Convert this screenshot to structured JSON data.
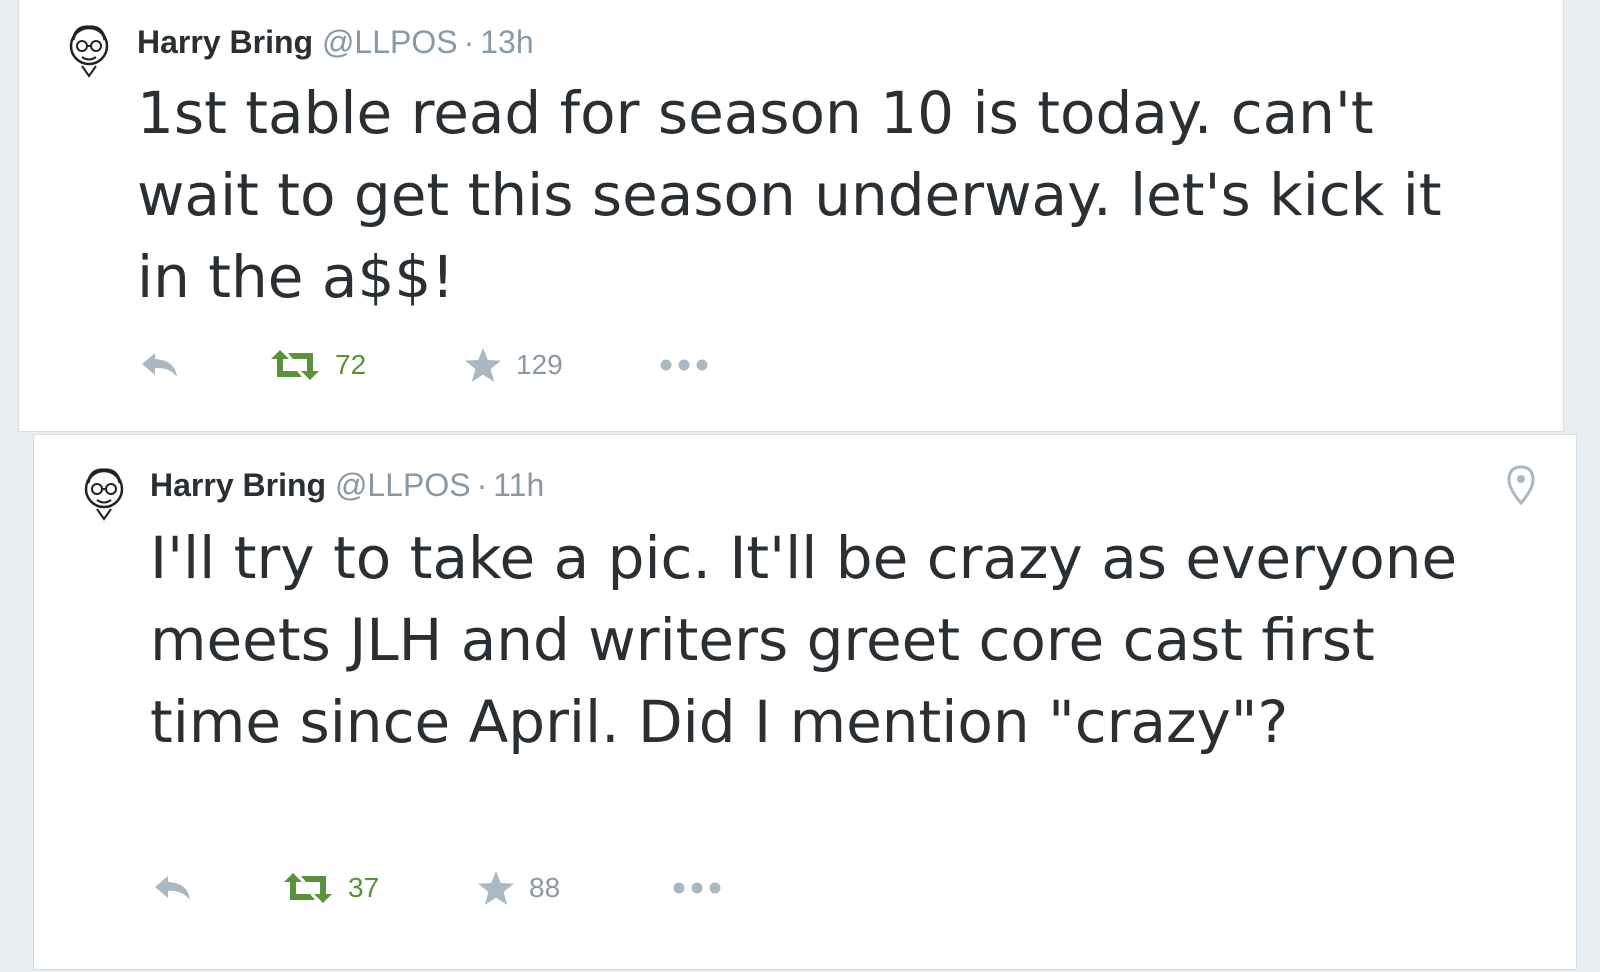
{
  "tweets": [
    {
      "name": "Harry Bring",
      "handle": "@LLPOS",
      "separator": "·",
      "time": "13h",
      "text": "1st table read for season 10 is today. can't wait to get this season underway. let's kick it in the a$$!",
      "retweets": "72",
      "favorites": "129",
      "icons": [
        "avatar",
        "reply-icon",
        "retweet-icon",
        "favorite-icon",
        "more-icon"
      ]
    },
    {
      "name": "Harry Bring",
      "handle": "@LLPOS",
      "separator": "·",
      "time": "11h",
      "text": "I'll try to take a pic. It'll be crazy as everyone meets JLH and writers greet core cast first time since April. Did I mention \"crazy\"?",
      "retweets": "37",
      "favorites": "88",
      "icons": [
        "avatar",
        "reply-icon",
        "retweet-icon",
        "favorite-icon",
        "more-icon",
        "location-icon"
      ]
    }
  ],
  "colors": {
    "retweet_active": "#5c913b",
    "icon_gray": "#aab8c2",
    "text": "#292f33",
    "meta": "#8899a6"
  }
}
